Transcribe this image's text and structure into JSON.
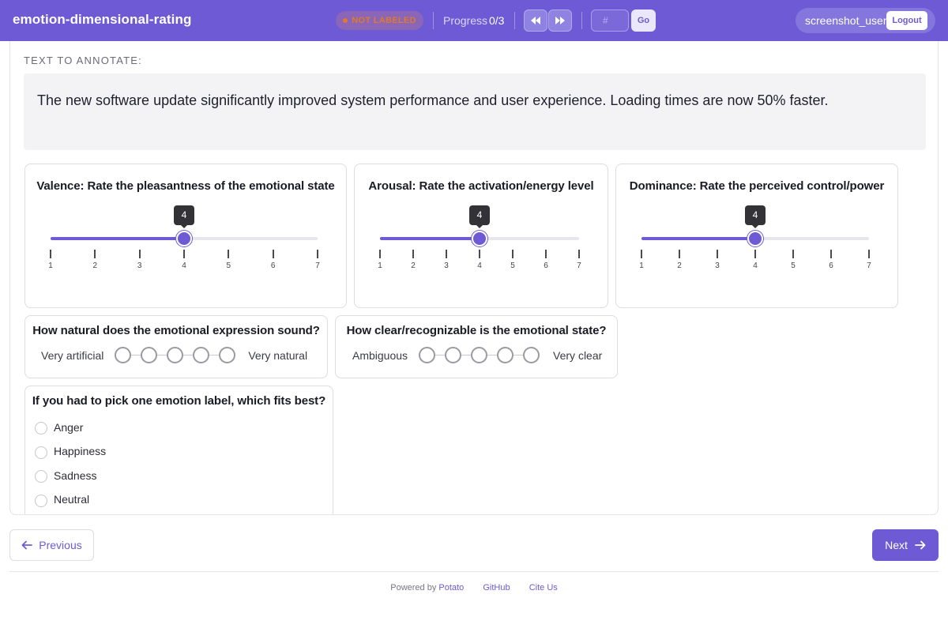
{
  "header": {
    "title": "emotion-dimensional-rating",
    "status_badge": "NOT LABELED",
    "progress_label": "Progress",
    "progress_value": "0/3",
    "jump_placeholder": "#",
    "go_label": "Go",
    "username": "screenshot_user",
    "logout_label": "Logout"
  },
  "instance": {
    "section_label": "TEXT TO ANNOTATE:",
    "text": "The new software update significantly improved system performance and user experience. Loading times are now 50% faster."
  },
  "sliders": [
    {
      "title": "Valence: Rate the pleasantness of the emotional state",
      "value": 4,
      "min": 1,
      "max": 7,
      "ticks": [
        "1",
        "2",
        "3",
        "4",
        "5",
        "6",
        "7"
      ]
    },
    {
      "title": "Arousal: Rate the activation/energy level",
      "value": 4,
      "min": 1,
      "max": 7,
      "ticks": [
        "1",
        "2",
        "3",
        "4",
        "5",
        "6",
        "7"
      ]
    },
    {
      "title": "Dominance: Rate the perceived control/power",
      "value": 4,
      "min": 1,
      "max": 7,
      "ticks": [
        "1",
        "2",
        "3",
        "4",
        "5",
        "6",
        "7"
      ]
    }
  ],
  "likerts": [
    {
      "title": "How natural does the emotional expression sound?",
      "min_label": "Very artificial",
      "max_label": "Very natural",
      "points": 5
    },
    {
      "title": "How clear/recognizable is the emotional state?",
      "min_label": "Ambiguous",
      "max_label": "Very clear",
      "points": 5
    }
  ],
  "radio": {
    "title": "If you had to pick one emotion label, which fits best?",
    "options": [
      "Anger",
      "Happiness",
      "Sadness",
      "Neutral"
    ]
  },
  "nav": {
    "previous_label": "Previous",
    "next_label": "Next"
  },
  "footer": {
    "powered_by": "Powered by",
    "potato": "Potato",
    "github": "GitHub",
    "cite": "Cite Us"
  },
  "colors": {
    "accent": "#6e5ad4",
    "status": "#e0782f"
  }
}
